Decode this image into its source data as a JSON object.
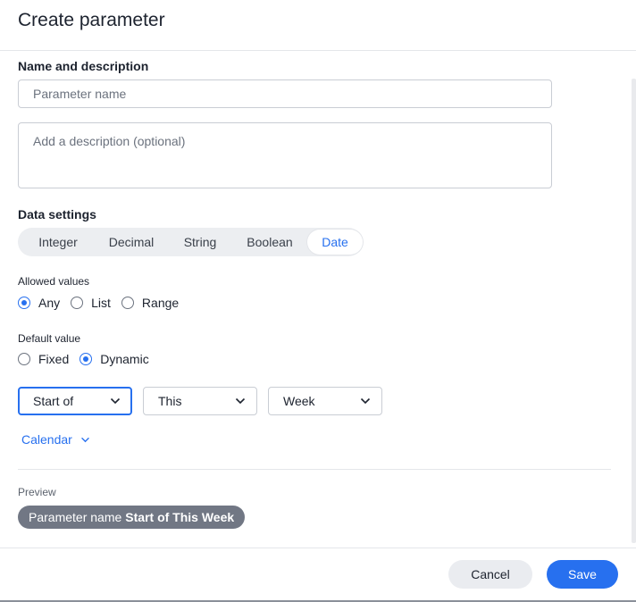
{
  "dialog": {
    "title": "Create parameter"
  },
  "name_section": {
    "title": "Name and description",
    "name_placeholder": "Parameter name",
    "description_placeholder": "Add a description (optional)"
  },
  "data_settings": {
    "title": "Data settings",
    "types": [
      "Integer",
      "Decimal",
      "String",
      "Boolean",
      "Date"
    ],
    "selected_type": "Date"
  },
  "allowed_values": {
    "label": "Allowed values",
    "options": [
      "Any",
      "List",
      "Range"
    ],
    "selected": "Any"
  },
  "default_value": {
    "label": "Default value",
    "options": [
      "Fixed",
      "Dynamic"
    ],
    "selected": "Dynamic"
  },
  "dynamic_selects": {
    "anchor": "Start of",
    "relative": "This",
    "period": "Week"
  },
  "calendar_link": {
    "label": "Calendar"
  },
  "preview": {
    "label": "Preview",
    "name": "Parameter name",
    "value": "Start of This Week"
  },
  "footer": {
    "cancel_label": "Cancel",
    "save_label": "Save"
  },
  "colors": {
    "accent": "#2770ef",
    "pill": "#717784"
  }
}
